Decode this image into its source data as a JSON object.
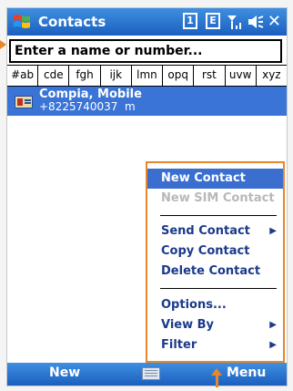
{
  "titlebar": {
    "title": "Contacts",
    "icons": [
      "windows-start-icon",
      "sim-icon",
      "e-mail-icon",
      "signal-icon",
      "speaker-icon",
      "close-icon"
    ],
    "close_glyph": "✕",
    "sim_label": "1",
    "e_label": "E"
  },
  "search": {
    "value": "Enter a name or number..."
  },
  "tabs": [
    "#ab",
    "cde",
    "fgh",
    "ijk",
    "lmn",
    "opq",
    "rst",
    "uvw",
    "xyz"
  ],
  "contacts": [
    {
      "name": "Compia, Mobile",
      "phone": "+8225740037",
      "type": "m"
    }
  ],
  "menu": {
    "items": [
      {
        "label": "New Contact",
        "state": "selected"
      },
      {
        "label": "New SIM Contact",
        "state": "disabled"
      },
      {
        "label": "Send Contact",
        "state": "submenu"
      },
      {
        "label": "Copy Contact",
        "state": "normal"
      },
      {
        "label": "Delete Contact",
        "state": "normal"
      },
      {
        "label": "Options...",
        "state": "normal"
      },
      {
        "label": "View By",
        "state": "submenu"
      },
      {
        "label": "Filter",
        "state": "submenu"
      }
    ]
  },
  "bottombar": {
    "left_softkey": "New",
    "right_softkey": "Menu"
  },
  "colors": {
    "accent": "#1b5fc0",
    "annotation": "#e8872a",
    "menu_text": "#1b3a8a"
  }
}
